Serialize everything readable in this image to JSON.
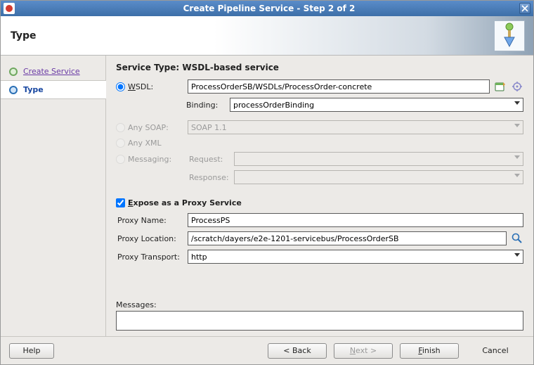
{
  "titlebar": {
    "title": "Create Pipeline Service - Step 2 of 2"
  },
  "header": {
    "heading": "Type"
  },
  "sidebar": {
    "items": [
      {
        "label": "Create Service"
      },
      {
        "label": "Type"
      }
    ]
  },
  "main": {
    "service_type_label": "Service Type: WSDL-based service",
    "wsdl": {
      "radio_label_pre": "",
      "radio_label_u": "W",
      "radio_label_post": "SDL:",
      "value": "ProcessOrderSB/WSDLs/ProcessOrder-concrete",
      "binding_label": "Binding:",
      "binding_value": "processOrderBinding"
    },
    "any_soap": {
      "label": "Any SOAP:",
      "value": "SOAP 1.1"
    },
    "any_xml": {
      "label": "Any XML"
    },
    "messaging": {
      "label": "Messaging:",
      "request_label": "Request:",
      "request_value": "",
      "response_label": "Response:",
      "response_value": ""
    },
    "expose": {
      "label_pre": "",
      "label_u": "E",
      "label_post": "xpose as a Proxy Service"
    },
    "proxy_name": {
      "label": "Proxy Name:",
      "value": "ProcessPS"
    },
    "proxy_location": {
      "label": "Proxy Location:",
      "value": "/scratch/dayers/e2e-1201-servicebus/ProcessOrderSB"
    },
    "proxy_transport": {
      "label": "Proxy Transport:",
      "value": "http"
    },
    "messages_label": "Messages:"
  },
  "footer": {
    "help": "Help",
    "back": "< Back",
    "next_pre": "",
    "next_u": "N",
    "next_post": "ext >",
    "finish_pre": "",
    "finish_u": "F",
    "finish_post": "inish",
    "cancel": "Cancel"
  }
}
